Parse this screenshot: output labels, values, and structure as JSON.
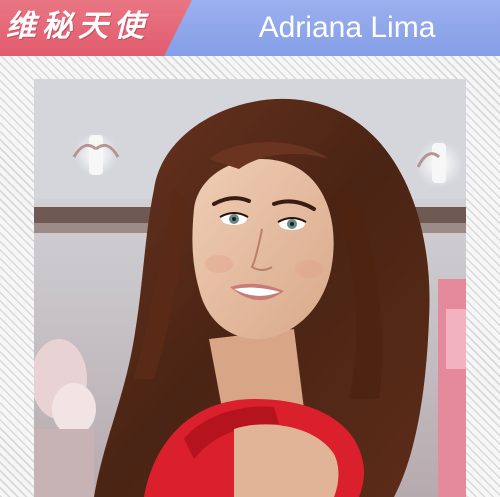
{
  "header": {
    "brand": "维秘天使",
    "model_name": "Adriana Lima"
  },
  "colors": {
    "brand_red": "#e4606f",
    "title_blue": "#8ea6ea",
    "dress_red": "#d9202c"
  },
  "photo": {
    "icon": "portrait-photo"
  }
}
